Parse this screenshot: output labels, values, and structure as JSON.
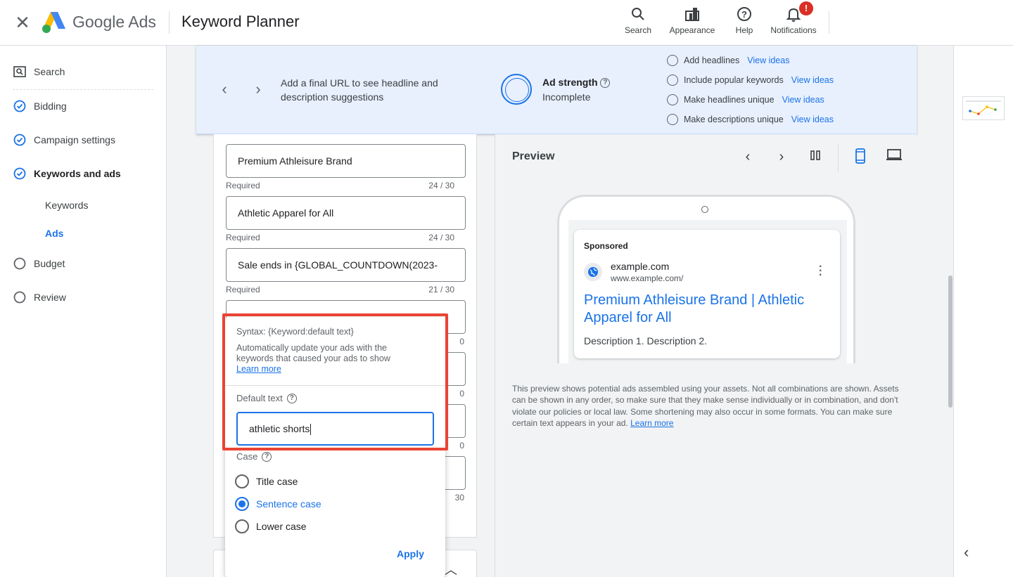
{
  "header": {
    "close_icon": "close-icon",
    "brand_google": "Google",
    "brand_ads": "Ads",
    "app_title": "Keyword Planner",
    "actions": [
      {
        "label": "Search",
        "icon": "search-icon"
      },
      {
        "label": "Appearance",
        "icon": "appearance-icon"
      },
      {
        "label": "Help",
        "icon": "help-icon"
      },
      {
        "label": "Notifications",
        "icon": "bell-icon",
        "badge": "!"
      }
    ]
  },
  "sidebar": {
    "items": [
      {
        "label": "Search",
        "icon": "search-box-icon"
      },
      {
        "label": "Bidding",
        "icon": "check-circle-icon"
      },
      {
        "label": "Campaign settings",
        "icon": "check-circle-icon"
      },
      {
        "label": "Keywords and ads",
        "icon": "check-circle-icon"
      },
      {
        "label": "Budget",
        "icon": "empty-circle-icon"
      },
      {
        "label": "Review",
        "icon": "empty-circle-icon"
      }
    ],
    "sub_items": [
      {
        "label": "Keywords",
        "active": false
      },
      {
        "label": "Ads",
        "active": true
      }
    ]
  },
  "banner": {
    "text": "Add a final URL to see headline and description suggestions",
    "strength_label": "Ad strength",
    "strength_value": "Incomplete",
    "tips": [
      {
        "label": "Add headlines",
        "link": "View ideas"
      },
      {
        "label": "Include popular keywords",
        "link": "View ideas"
      },
      {
        "label": "Make headlines unique",
        "link": "View ideas"
      },
      {
        "label": "Make descriptions unique",
        "link": "View ideas"
      }
    ]
  },
  "headlines": [
    {
      "value": "Premium Athleisure Brand",
      "hint": "Required",
      "count": "24 / 30"
    },
    {
      "value": "Athletic Apparel for All",
      "hint": "Required",
      "count": "24 / 30"
    },
    {
      "value": "Sale ends in {GLOBAL_COUNTDOWN(2023-",
      "hint": "Required",
      "count": "21 / 30"
    }
  ],
  "hidden_counts": [
    "0",
    "0",
    "0",
    "30"
  ],
  "preview": {
    "title": "Preview",
    "sponsored": "Sponsored",
    "domain": "example.com",
    "url": "www.example.com/",
    "headline": "Premium Athleisure Brand | Athletic Apparel for All",
    "description": "Description 1. Description 2.",
    "note": "This preview shows potential ads assembled using your assets. Not all combinations are shown. Assets can be shown in any order, so make sure that they make sense individually or in combination, and don't violate our policies or local law. Some shortening may also occur in some formats. You can make sure certain text appears in your ad.",
    "note_link": "Learn more"
  },
  "popup": {
    "syntax": "Syntax: {Keyword:default text}",
    "description": "Automatically update your ads with the keywords that caused your ads to show",
    "learn_more": "Learn more",
    "default_label": "Default text",
    "default_value": "athletic shorts",
    "case_label": "Case",
    "options": [
      {
        "label": "Title case",
        "selected": false
      },
      {
        "label": "Sentence case",
        "selected": true
      },
      {
        "label": "Lower case",
        "selected": false
      }
    ],
    "apply": "Apply"
  },
  "colors": {
    "accent": "#1a73e8",
    "highlight": "#ea4335",
    "banner_bg": "#e8f0fe"
  }
}
